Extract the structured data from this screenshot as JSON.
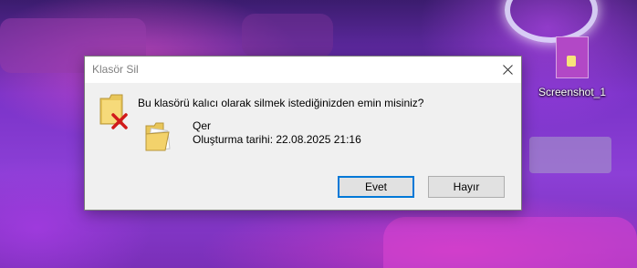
{
  "dialog": {
    "title": "Klasör Sil",
    "question": "Bu klasörü kalıcı olarak silmek istediğinizden emin misiniz?",
    "item_name": "Qer",
    "item_date": "Oluşturma tarihi: 22.08.2025 21:16",
    "yes_label": "Evet",
    "no_label": "Hayır",
    "icons": {
      "close": "close-icon",
      "delete_folder": "folder-delete-icon",
      "folder": "folder-icon"
    }
  },
  "desktop": {
    "icon_label": "Screenshot_1"
  },
  "colors": {
    "dialog_bg": "#f0f0f0",
    "focus_border": "#0078d7",
    "delete_red": "#d11a1a"
  }
}
